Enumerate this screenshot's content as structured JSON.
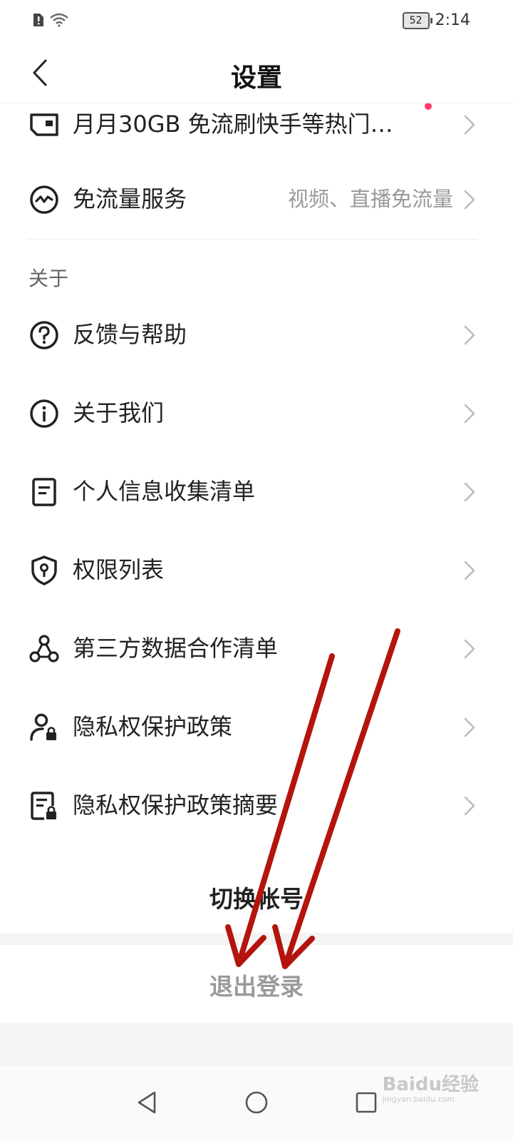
{
  "status_bar": {
    "battery": "52",
    "time": "2:14"
  },
  "header": {
    "title": "设置"
  },
  "promo_row": {
    "label": "月月30GB 免流刷快手等热门…"
  },
  "rows_top": [
    {
      "label": "免流量服务",
      "value": "视频、直播免流量",
      "icon": "free-data-icon"
    }
  ],
  "section": {
    "title": "关于"
  },
  "about_items": [
    {
      "label": "反馈与帮助",
      "icon": "question-icon"
    },
    {
      "label": "关于我们",
      "icon": "info-icon"
    },
    {
      "label": "个人信息收集清单",
      "icon": "document-icon"
    },
    {
      "label": "权限列表",
      "icon": "shield-key-icon"
    },
    {
      "label": "第三方数据合作清单",
      "icon": "network-icon"
    },
    {
      "label": "隐私权保护政策",
      "icon": "user-lock-icon"
    },
    {
      "label": "隐私权保护政策摘要",
      "icon": "document-lock-icon"
    }
  ],
  "actions": {
    "switch_account": "切换帐号",
    "logout": "退出登录"
  },
  "watermark": {
    "brand": "Baidu经验",
    "url": "jingyan.baidu.com"
  }
}
